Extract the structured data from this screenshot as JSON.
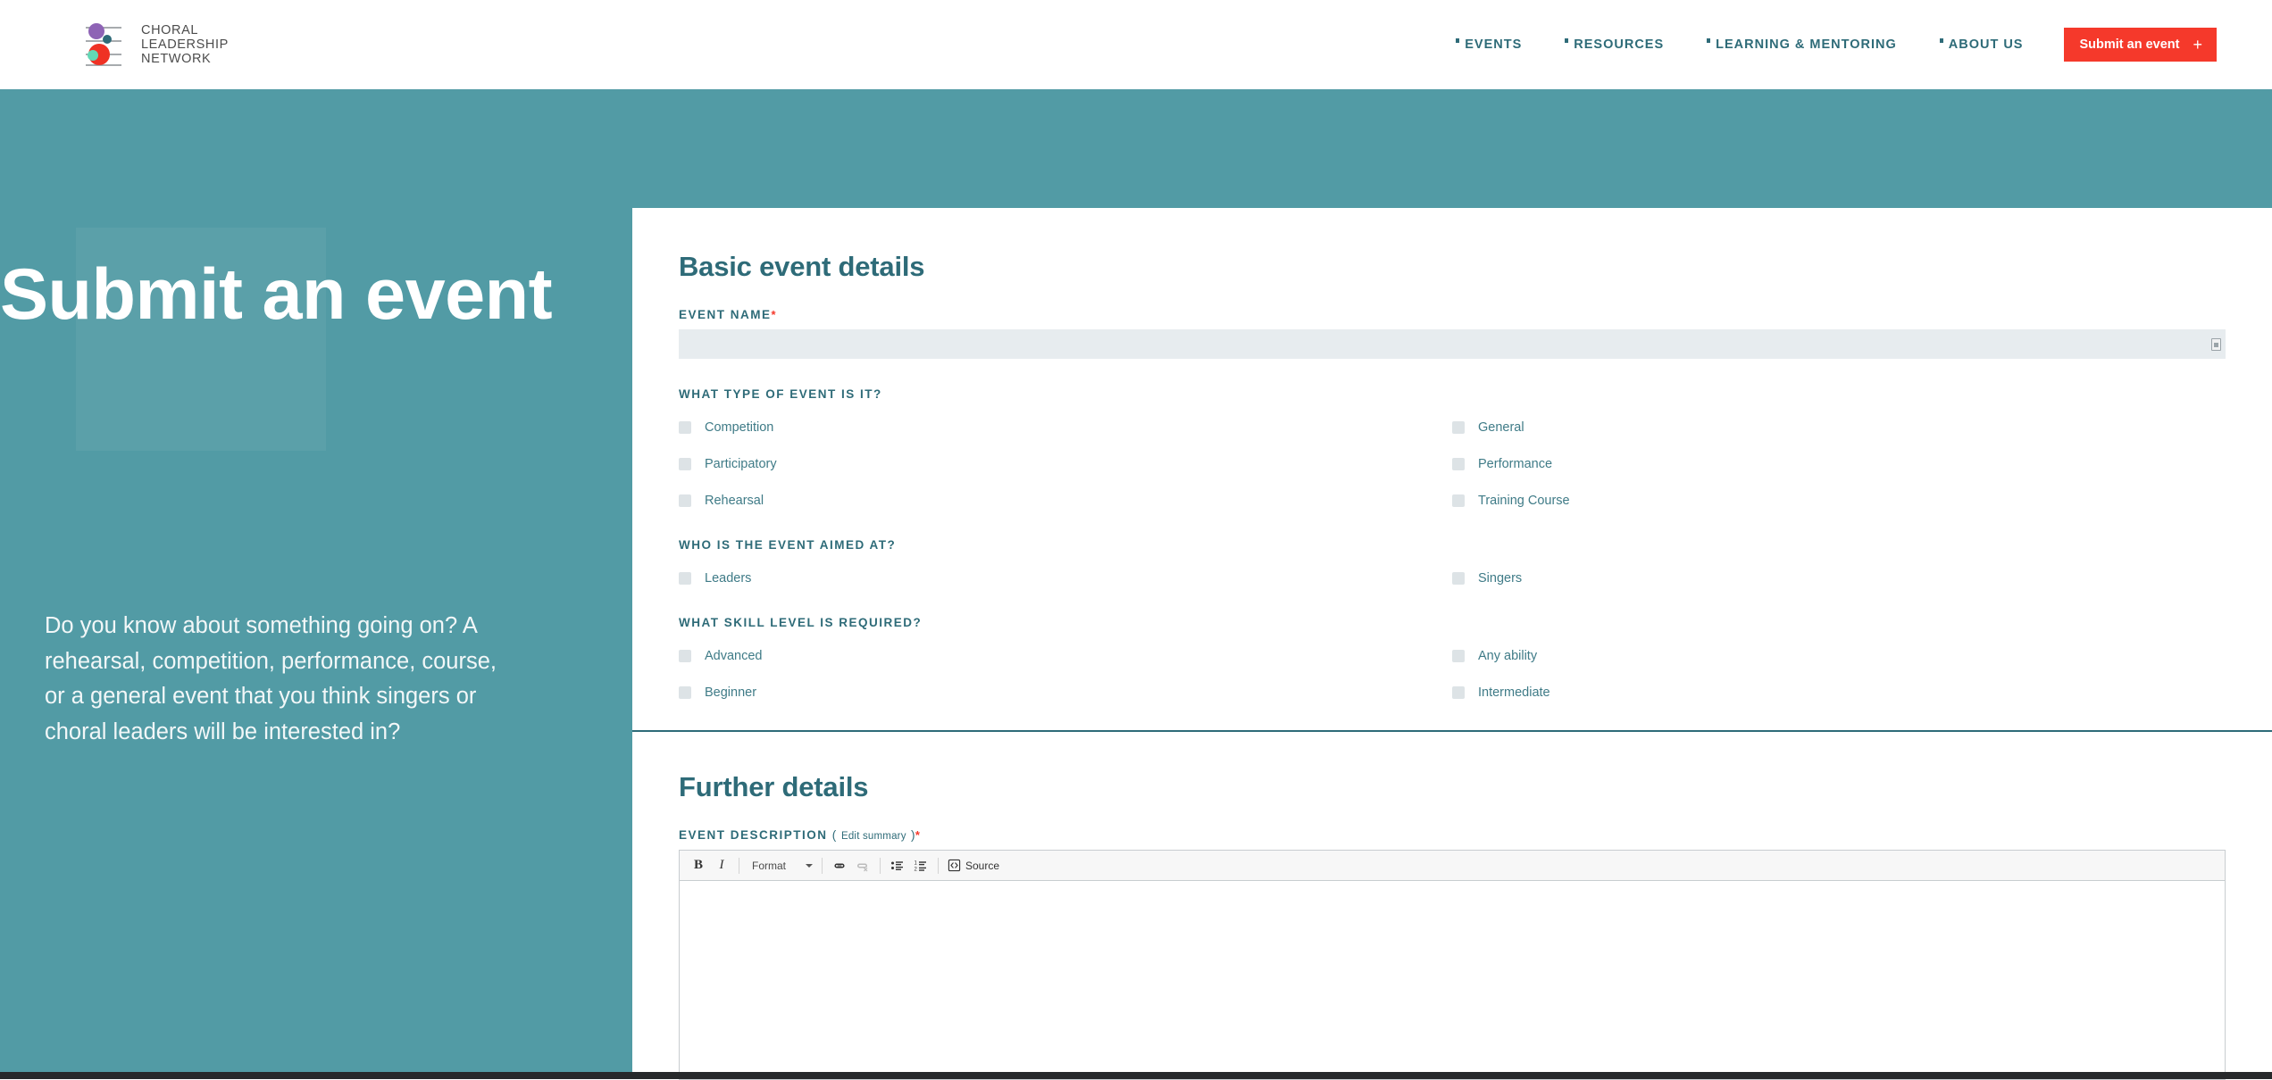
{
  "header": {
    "logo": {
      "line1": "CHORAL",
      "line2": "LEADERSHIP",
      "line3": "NETWORK",
      "icon": "choral-network-logo"
    },
    "nav": [
      {
        "label": "EVENTS"
      },
      {
        "label": "RESOURCES"
      },
      {
        "label": "LEARNING & MENTORING"
      },
      {
        "label": "ABOUT US"
      }
    ],
    "cta": {
      "label": "Submit an event",
      "icon": "plus-icon"
    }
  },
  "hero": {
    "title": "Submit an event",
    "description": "Do you know about something going on? A rehearsal, competition, performance, course, or a general event that you think singers or choral leaders will be interested in?"
  },
  "form": {
    "basic": {
      "heading": "Basic event details",
      "event_name": {
        "label": "EVENT NAME",
        "required": "*",
        "value": "",
        "placeholder": "",
        "grip_icon": "resize-grip-icon"
      },
      "event_type": {
        "label": "WHAT TYPE OF EVENT IS IT?",
        "left": [
          "Competition",
          "Participatory",
          "Rehearsal"
        ],
        "right": [
          "General",
          "Performance",
          "Training Course"
        ]
      },
      "aimed_at": {
        "label": "WHO IS THE EVENT AIMED AT?",
        "left": [
          "Leaders"
        ],
        "right": [
          "Singers"
        ]
      },
      "skill_level": {
        "label": "WHAT SKILL LEVEL IS REQUIRED?",
        "left": [
          "Advanced",
          "Beginner"
        ],
        "right": [
          "Any ability",
          "Intermediate"
        ]
      }
    },
    "further": {
      "heading": "Further details",
      "description_field": {
        "label": "EVENT DESCRIPTION",
        "paren_open": "(",
        "edit_summary": "Edit summary",
        "paren_close": ")",
        "required": "*",
        "value": ""
      },
      "editor_toolbar": {
        "bold": "B",
        "italic": "I",
        "format": "Format",
        "link_icon": "link-icon",
        "unlink_icon": "unlink-icon",
        "bulleted_list_icon": "bulleted-list-icon",
        "numbered_list_icon": "numbered-list-icon",
        "source_label": "Source",
        "source_icon": "source-code-icon"
      }
    }
  },
  "colors": {
    "teal": "#529ba5",
    "dark_teal": "#2e6b78",
    "red": "#f5392b",
    "input_bg": "#e7ecef",
    "checkbox": "#dde3e6"
  }
}
